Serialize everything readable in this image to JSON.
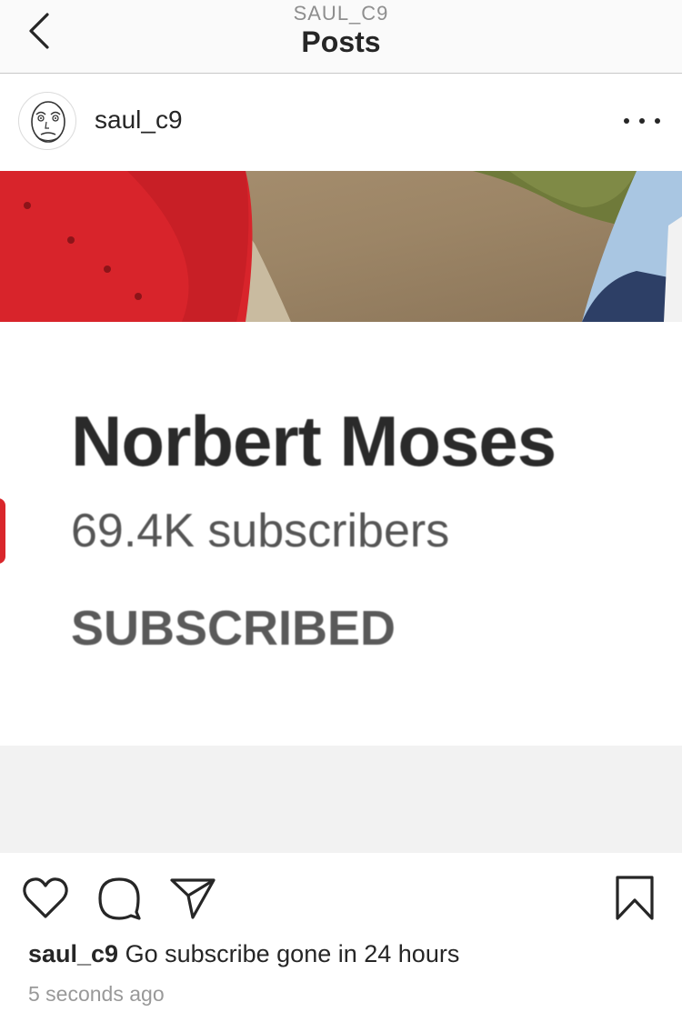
{
  "header": {
    "subtitle": "SAUL_C9",
    "title": "Posts"
  },
  "post": {
    "username": "saul_c9",
    "image": {
      "channel_name": "Norbert Moses",
      "subscribers": "69.4K subscribers",
      "status": "SUBSCRIBED"
    },
    "caption": {
      "username": "saul_c9",
      "text": "Go subscribe gone in 24 hours"
    },
    "timestamp": "5 seconds ago"
  },
  "icons": {
    "back": "chevron-left-icon",
    "more": "more-horizontal-icon",
    "like": "heart-icon",
    "comment": "comment-icon",
    "share": "paper-plane-icon",
    "save": "bookmark-icon"
  },
  "colors": {
    "text": "#262626",
    "muted": "#8e8e8e",
    "header_bg": "#fafafa",
    "red": "#d9262b"
  }
}
